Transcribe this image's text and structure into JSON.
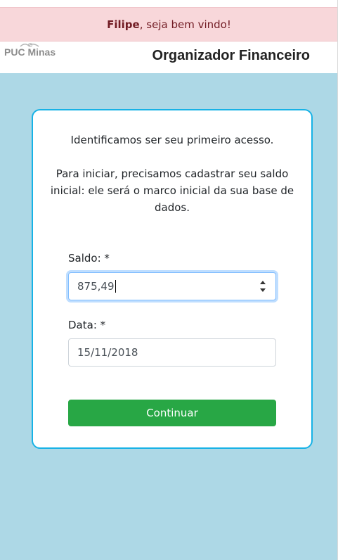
{
  "alert": {
    "user_name": "Filipe",
    "message": ", seja bem vindo!"
  },
  "header": {
    "logo_text": "PUC Minas",
    "app_title": "Organizador Financeiro"
  },
  "card": {
    "intro_line1": "Identificamos ser seu primeiro acesso.",
    "intro_line2": "Para iniciar, precisamos cadastrar seu saldo inicial: ele será o marco inicial da sua base de dados.",
    "saldo_label": "Saldo: *",
    "saldo_value": "875,49",
    "data_label": "Data: *",
    "data_value": "15/11/2018",
    "button_label": "Continuar"
  },
  "colors": {
    "background": "#add8e6",
    "alert_bg": "#f8d7da",
    "alert_text": "#721c24",
    "card_border": "#17b2e6",
    "button": "#28a745"
  }
}
